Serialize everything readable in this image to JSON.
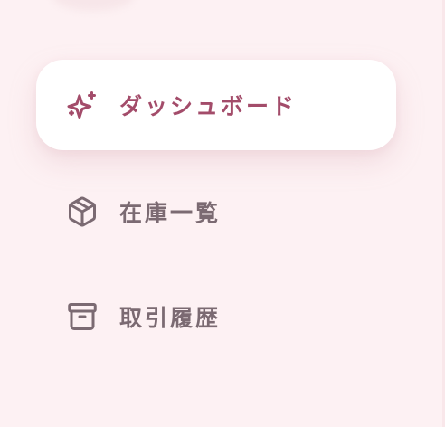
{
  "sidebar": {
    "items": [
      {
        "label": "ダッシュボード",
        "icon": "sparkles-icon",
        "active": true
      },
      {
        "label": "在庫一覧",
        "icon": "package-icon",
        "active": false
      },
      {
        "label": "取引履歴",
        "icon": "archive-icon",
        "active": false
      }
    ]
  },
  "colors": {
    "background": "#fdf1f3",
    "active_item_background": "#ffffff",
    "active_text": "#a34c6a",
    "inactive_text": "#7b6a72"
  }
}
